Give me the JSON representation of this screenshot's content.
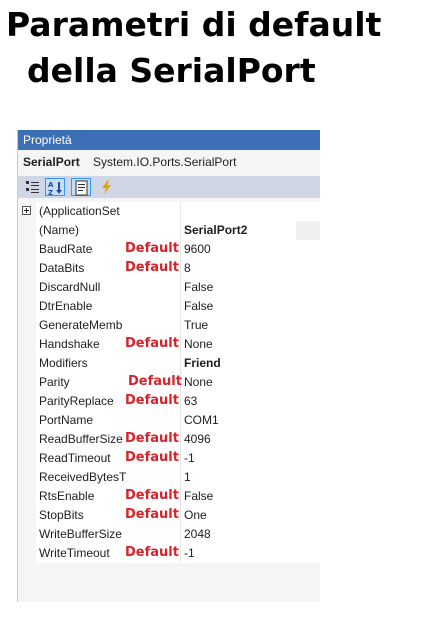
{
  "title": {
    "line1": "Parametri di default",
    "line2": "della SerialPort"
  },
  "panel": {
    "header": "Proprietà",
    "object_name": "SerialPort",
    "object_type": "System.IO.Ports.SerialPort"
  },
  "toolbar": {
    "buttons": [
      {
        "icon": "categorized-icon"
      },
      {
        "icon": "alphabetical-sort-icon",
        "active": true
      },
      {
        "icon": "properties-page-icon",
        "active": true
      },
      {
        "icon": "events-lightning-icon"
      }
    ]
  },
  "properties": [
    {
      "name": "(ApplicationSet",
      "value": "",
      "expandable": true
    },
    {
      "name": "(Name)",
      "value": "SerialPort2",
      "bold": true
    },
    {
      "name": "BaudRate",
      "value": "9600",
      "default": true
    },
    {
      "name": "DataBits",
      "value": "8",
      "default": true
    },
    {
      "name": "DiscardNull",
      "value": "False"
    },
    {
      "name": "DtrEnable",
      "value": "False"
    },
    {
      "name": "GenerateMemb",
      "value": "True"
    },
    {
      "name": "Handshake",
      "value": "None",
      "default": true
    },
    {
      "name": "Modifiers",
      "value": "Friend",
      "bold": true
    },
    {
      "name": "Parity",
      "value": "None",
      "default": true
    },
    {
      "name": "ParityReplace",
      "value": "63",
      "default": true
    },
    {
      "name": "PortName",
      "value": "COM1"
    },
    {
      "name": "ReadBufferSize",
      "value": "4096",
      "default": true
    },
    {
      "name": "ReadTimeout",
      "value": "-1",
      "default": true
    },
    {
      "name": "ReceivedBytesT",
      "value": "1"
    },
    {
      "name": "RtsEnable",
      "value": "False",
      "default": true
    },
    {
      "name": "StopBits",
      "value": "One",
      "default": true
    },
    {
      "name": "WriteBufferSize",
      "value": "2048"
    },
    {
      "name": "WriteTimeout",
      "value": "-1",
      "default": true
    }
  ],
  "default_label": "Default",
  "colors": {
    "header_bg": "#3c6fb5",
    "toolbar_bg": "#cfd6e5",
    "default_red": "#d9232a"
  }
}
